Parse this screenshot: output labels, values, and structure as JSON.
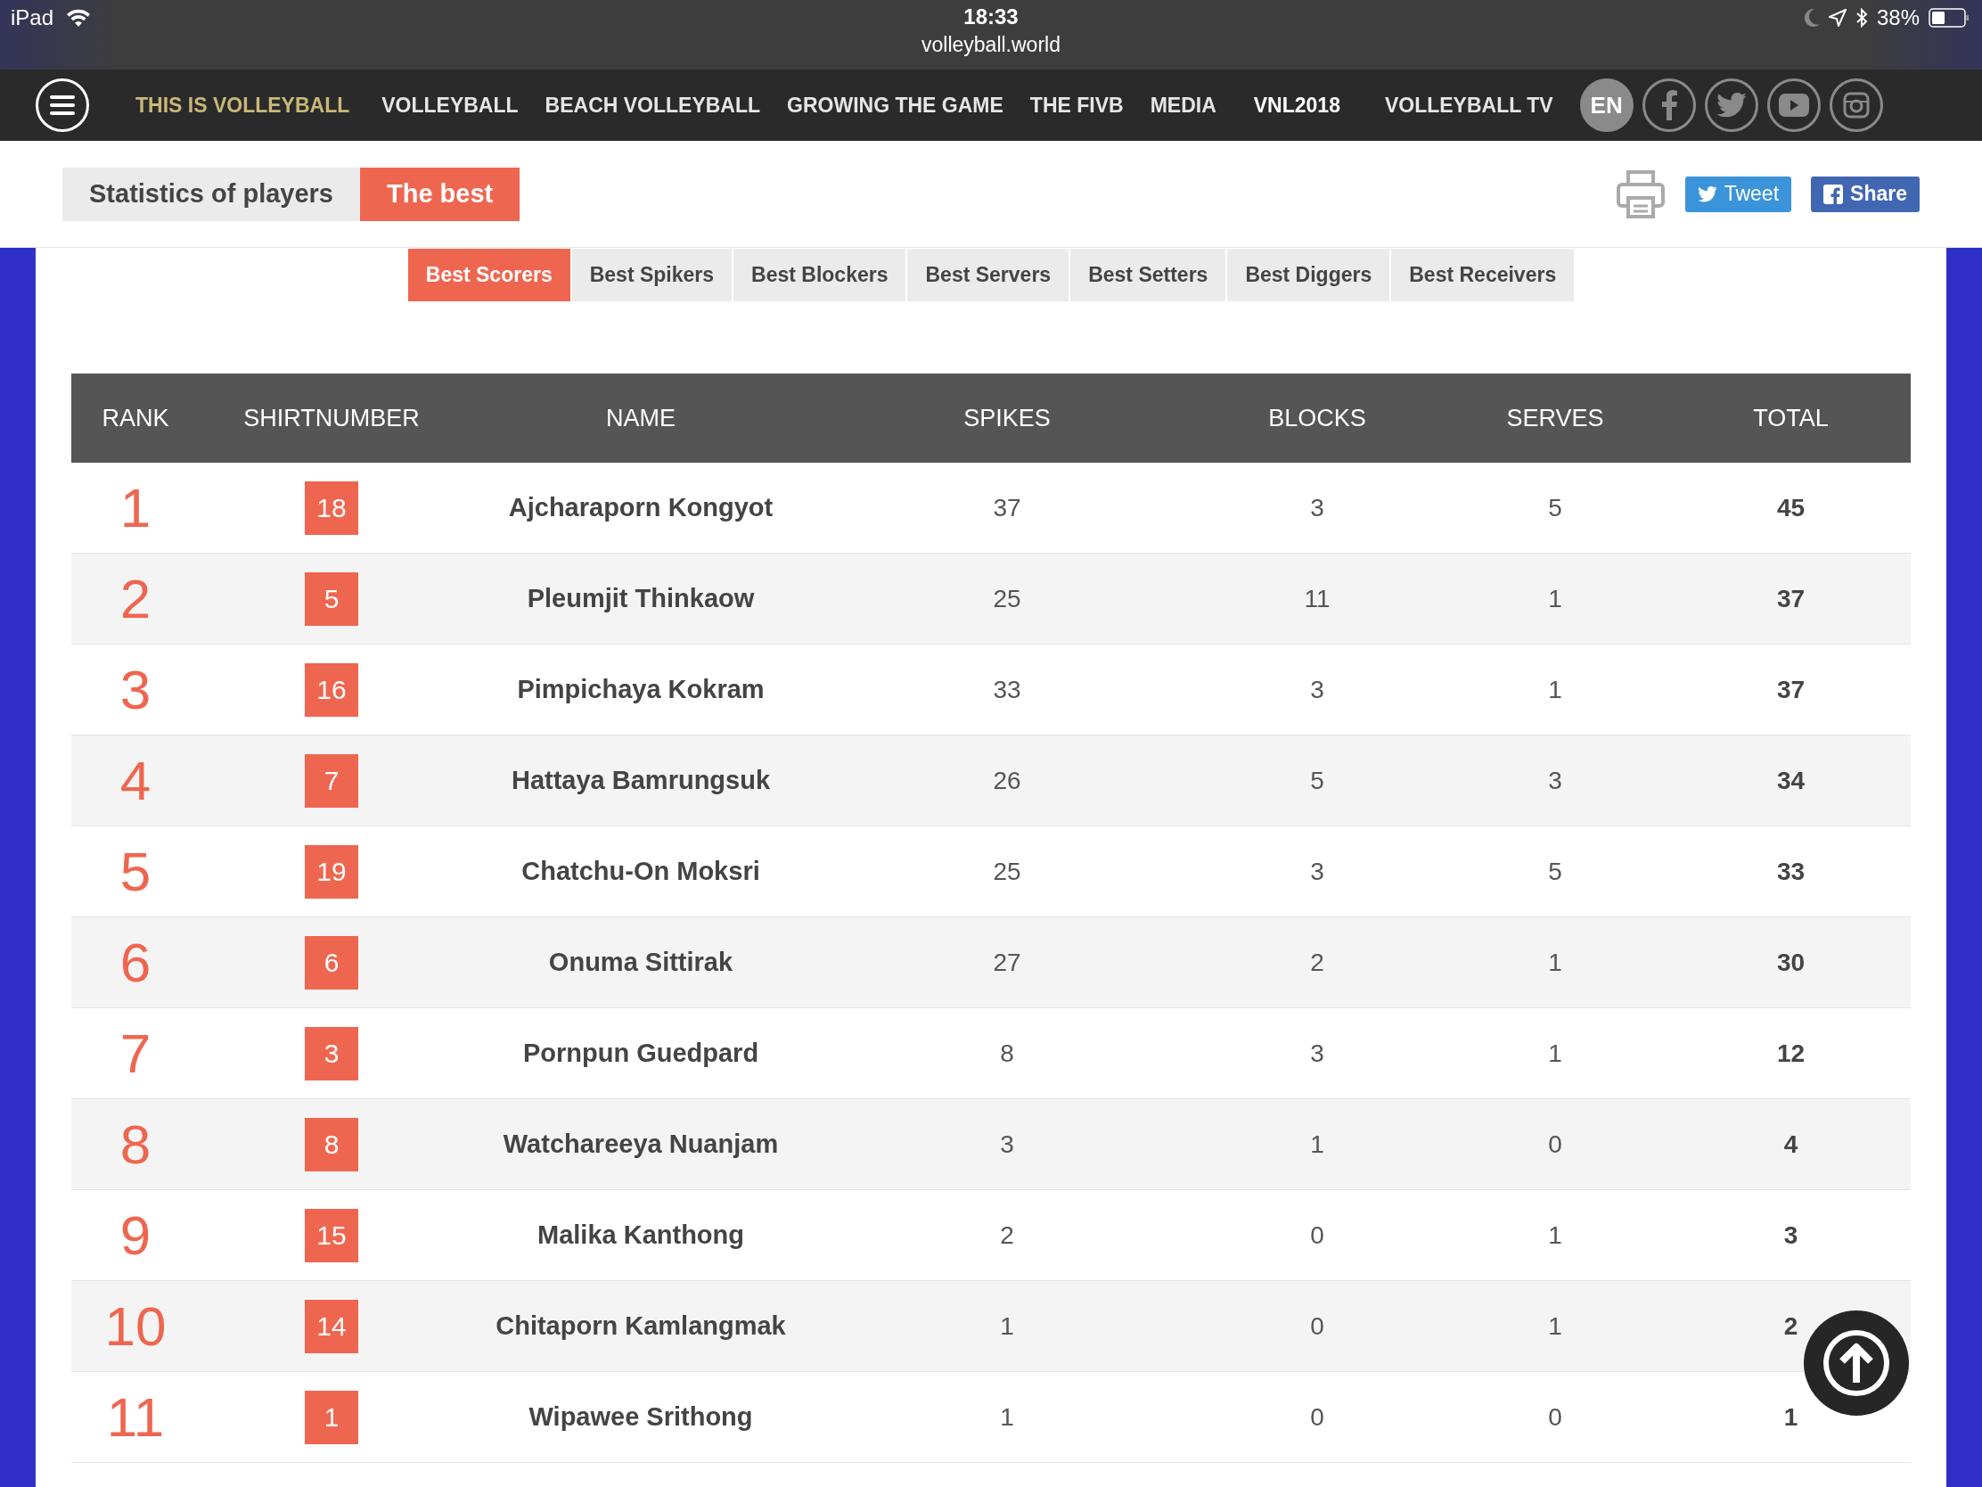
{
  "status_bar": {
    "device": "iPad",
    "time": "18:33",
    "url": "volleyball.world",
    "battery": "38%"
  },
  "nav": {
    "brand": "THIS IS VOLLEYBALL",
    "links": [
      {
        "label": "VOLLEYBALL",
        "highlighted": false
      },
      {
        "label": "BEACH VOLLEYBALL",
        "highlighted": false
      },
      {
        "label": "GROWING THE GAME",
        "highlighted": false
      },
      {
        "label": "THE FIVB",
        "highlighted": false
      },
      {
        "label": "MEDIA",
        "highlighted": false
      },
      {
        "label": "VNL2018",
        "highlighted": true
      },
      {
        "label": "VOLLEYBALL TV",
        "highlighted": false
      }
    ],
    "language": "EN"
  },
  "page_tabs": [
    {
      "label": "Statistics of players",
      "selected": false
    },
    {
      "label": "The best",
      "selected": true
    }
  ],
  "share_buttons": [
    {
      "kind": "twitter",
      "label": "Tweet"
    },
    {
      "kind": "facebook",
      "label": "Share"
    }
  ],
  "category_tabs": [
    {
      "label": "Best Scorers",
      "selected": true
    },
    {
      "label": "Best Spikers",
      "selected": false
    },
    {
      "label": "Best Blockers",
      "selected": false
    },
    {
      "label": "Best Servers",
      "selected": false
    },
    {
      "label": "Best Setters",
      "selected": false
    },
    {
      "label": "Best Diggers",
      "selected": false
    },
    {
      "label": "Best Receivers",
      "selected": false
    }
  ],
  "table": {
    "columns": [
      "RANK",
      "SHIRTNUMBER",
      "NAME",
      "SPIKES",
      "BLOCKS",
      "SERVES",
      "TOTAL"
    ],
    "rows": [
      {
        "rank": "1",
        "shirt": "18",
        "name": "Ajcharaporn Kongyot",
        "spikes": "37",
        "blocks": "3",
        "serves": "5",
        "total": "45"
      },
      {
        "rank": "2",
        "shirt": "5",
        "name": "Pleumjit Thinkaow",
        "spikes": "25",
        "blocks": "11",
        "serves": "1",
        "total": "37"
      },
      {
        "rank": "3",
        "shirt": "16",
        "name": "Pimpichaya Kokram",
        "spikes": "33",
        "blocks": "3",
        "serves": "1",
        "total": "37"
      },
      {
        "rank": "4",
        "shirt": "7",
        "name": "Hattaya Bamrungsuk",
        "spikes": "26",
        "blocks": "5",
        "serves": "3",
        "total": "34"
      },
      {
        "rank": "5",
        "shirt": "19",
        "name": "Chatchu-On Moksri",
        "spikes": "25",
        "blocks": "3",
        "serves": "5",
        "total": "33"
      },
      {
        "rank": "6",
        "shirt": "6",
        "name": "Onuma Sittirak",
        "spikes": "27",
        "blocks": "2",
        "serves": "1",
        "total": "30"
      },
      {
        "rank": "7",
        "shirt": "3",
        "name": "Pornpun Guedpard",
        "spikes": "8",
        "blocks": "3",
        "serves": "1",
        "total": "12"
      },
      {
        "rank": "8",
        "shirt": "8",
        "name": "Watchareeya Nuanjam",
        "spikes": "3",
        "blocks": "1",
        "serves": "0",
        "total": "4"
      },
      {
        "rank": "9",
        "shirt": "15",
        "name": "Malika Kanthong",
        "spikes": "2",
        "blocks": "0",
        "serves": "1",
        "total": "3"
      },
      {
        "rank": "10",
        "shirt": "14",
        "name": "Chitaporn Kamlangmak",
        "spikes": "1",
        "blocks": "0",
        "serves": "1",
        "total": "2"
      },
      {
        "rank": "11",
        "shirt": "1",
        "name": "Wipawee Srithong",
        "spikes": "1",
        "blocks": "0",
        "serves": "0",
        "total": "1"
      }
    ]
  }
}
